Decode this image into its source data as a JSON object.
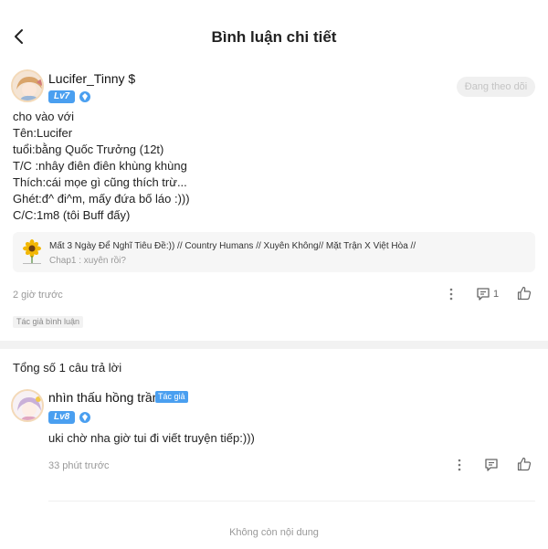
{
  "header": {
    "title": "Bình luận chi tiết",
    "back_icon": "chevron-left-icon"
  },
  "comment": {
    "username": "Lucifer_Tinny $",
    "level": "Lv7",
    "follow_label": "Đang theo dõi",
    "lines": [
      "cho vào với",
      "Tên:Lucifer",
      "tuổi:bằng Quốc Trưởng (12t)",
      "T/C :nhây điên điên khùng khùng",
      "Thích:cái mọe gì cũng thích trừ...",
      "Ghét:đ^ đi^m, mấy đứa bố láo :)))",
      "C/C:1m8 (tôi Buff đấy)"
    ],
    "story": {
      "title": "Mất 3 Ngày Để Nghĩ Tiêu Đề:)) // Country Humans // Xuyên Không// Mặt Trận X Việt Hòa //",
      "chapter": "Chap1 : xuyên rồi?"
    },
    "time": "2 giờ trước",
    "reply_count": "1",
    "author_tag": "Tác giả bình luận"
  },
  "replies": {
    "total_label": "Tổng số 1 câu trả lời",
    "items": [
      {
        "username": "nhìn thấu hồng trần",
        "author_badge": "Tác giả",
        "level": "Lv8",
        "text": "uki chờ nha giờ tui đi viết truyện tiếp:)))",
        "time": "33 phút trước"
      }
    ]
  },
  "footer": {
    "no_more": "Không còn nội dung"
  },
  "colors": {
    "accent": "#4a9ff0",
    "muted": "#999999",
    "band": "#f2f2f2"
  }
}
